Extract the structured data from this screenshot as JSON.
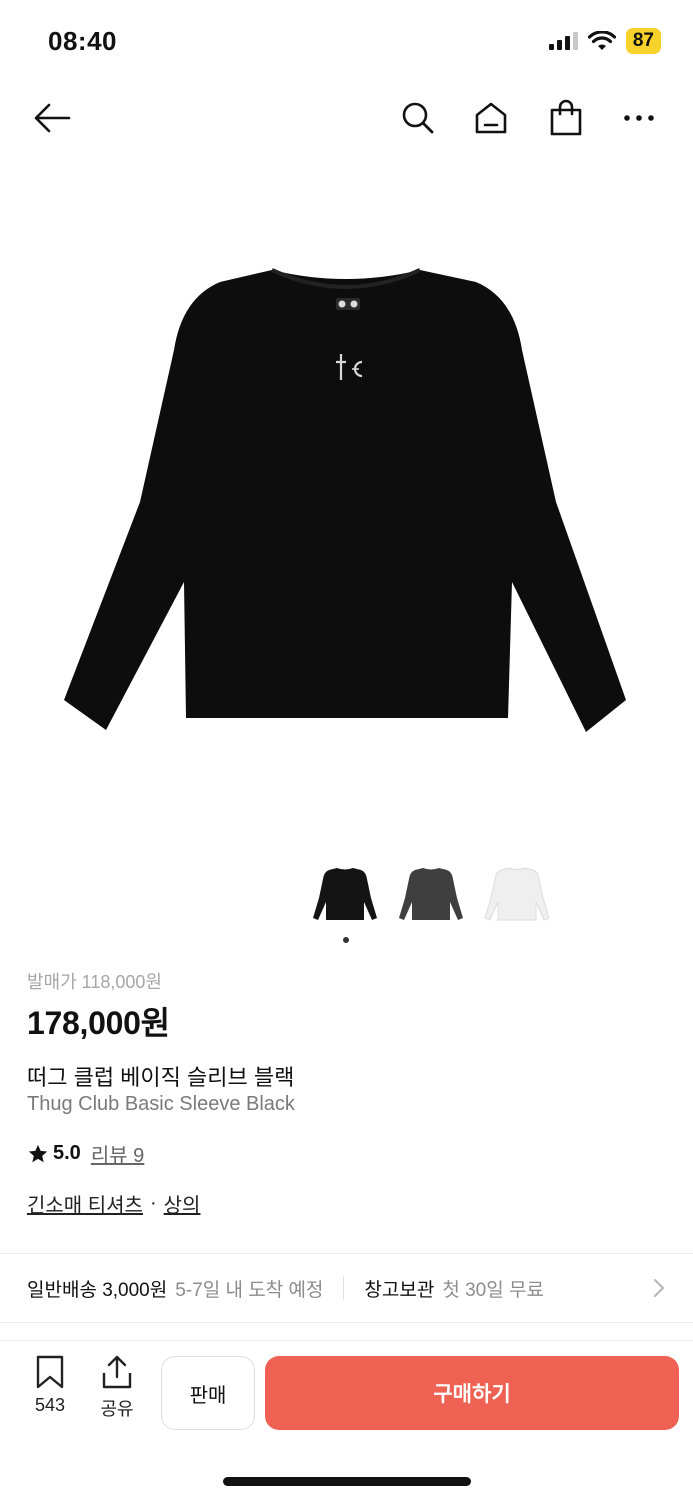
{
  "status": {
    "time": "08:40",
    "battery": "87"
  },
  "nav": {
    "icons": [
      "back-arrow-icon",
      "search-icon",
      "home-icon",
      "shopping-bag-icon",
      "more-icon"
    ]
  },
  "product": {
    "release_price": "발매가 118,000원",
    "price": "178,000원",
    "name_ko": "떠그 클럽 베이직 슬리브 블랙",
    "name_en": "Thug Club Basic Sleeve Black",
    "rating": "5.0",
    "review_link": "리뷰 9",
    "category_1": "긴소매 티셔츠",
    "category_sep": "·",
    "category_2": "상의",
    "thumbnail_colors": [
      "#141414",
      "#3f3f3f",
      "#efefef"
    ],
    "selected_image_index": 1
  },
  "shipping": {
    "standard_label": "일반배송 3,000원",
    "standard_eta": "5-7일 내 도착 예정",
    "storage_label": "창고보관",
    "storage_note": "첫 30일 무료"
  },
  "bottom": {
    "save_count": "543",
    "share_label": "공유",
    "sell_label": "판매",
    "buy_label": "구매하기"
  },
  "colors": {
    "buy_button": "#ef6253",
    "battery": "#f7d22a"
  }
}
